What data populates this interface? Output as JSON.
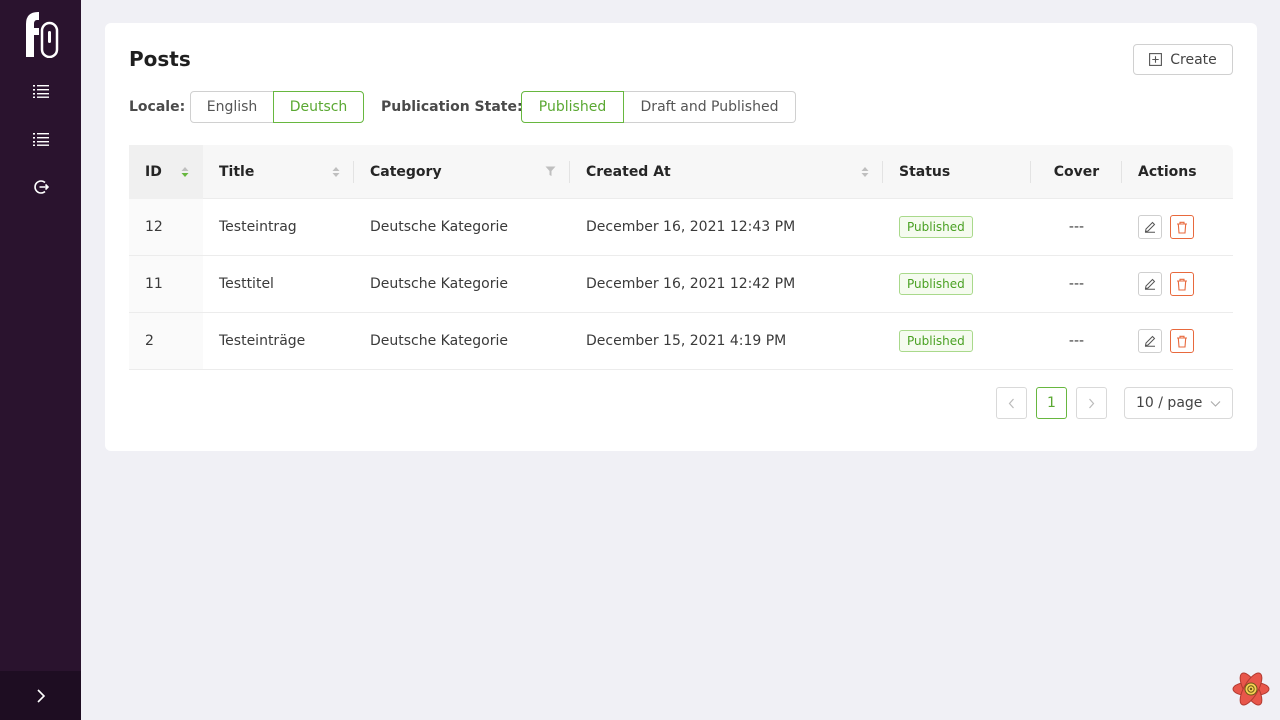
{
  "app": {
    "logo_text": "f"
  },
  "sidebar": {
    "items": [
      {
        "icon": "list-icon"
      },
      {
        "icon": "list-icon"
      },
      {
        "icon": "logout-icon"
      }
    ],
    "collapse_icon": "chevron-right-icon"
  },
  "page": {
    "title": "Posts",
    "create_label": "Create"
  },
  "filters": {
    "locale_label": "Locale:",
    "locale_options": [
      "English",
      "Deutsch"
    ],
    "locale_selected": "Deutsch",
    "publication_label": "Publication State:",
    "publication_options": [
      "Published",
      "Draft and Published"
    ],
    "publication_selected": "Published"
  },
  "table": {
    "columns": [
      "ID",
      "Title",
      "Category",
      "Created At",
      "Status",
      "Cover",
      "Actions"
    ],
    "rows": [
      {
        "id": "12",
        "title": "Testeintrag",
        "category": "Deutsche Kategorie",
        "created_at": "December 16, 2021 12:43 PM",
        "status": "Published",
        "cover": "---"
      },
      {
        "id": "11",
        "title": "Testtitel",
        "category": "Deutsche Kategorie",
        "created_at": "December 16, 2021 12:42 PM",
        "status": "Published",
        "cover": "---"
      },
      {
        "id": "2",
        "title": "Testeinträge",
        "category": "Deutsche Kategorie",
        "created_at": "December 15, 2021 4:19 PM",
        "status": "Published",
        "cover": "---"
      }
    ]
  },
  "pagination": {
    "current_page": "1",
    "page_size": "10 / page"
  },
  "colors": {
    "sidebar_bg": "#2a132e",
    "accent_green": "#67b73f",
    "danger": "#e8693d"
  }
}
